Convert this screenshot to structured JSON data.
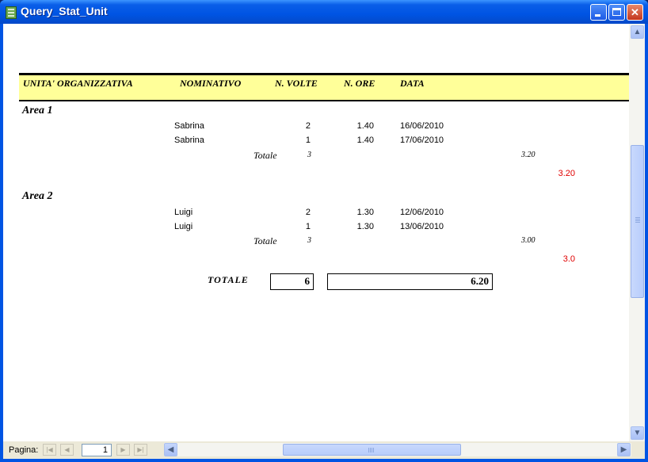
{
  "window": {
    "title": "Query_Stat_Unit"
  },
  "report": {
    "columns": {
      "unit": "UNITA' ORGANIZZATIVA",
      "name": "NOMINATIVO",
      "count": "N. VOLTE",
      "hours": "N. ORE",
      "date": "DATA"
    },
    "groups": [
      {
        "area": "Area 1",
        "rows": [
          {
            "name": "Sabrina",
            "count": "2",
            "hours": "1.40",
            "date": "16/06/2010"
          },
          {
            "name": "Sabrina",
            "count": "1",
            "hours": "1.40",
            "date": "17/06/2010"
          }
        ],
        "total_label": "Totale",
        "total_count": "3",
        "total_hours": "3.20",
        "total_red": "3.20"
      },
      {
        "area": "Area 2",
        "rows": [
          {
            "name": "Luigi",
            "count": "2",
            "hours": "1.30",
            "date": "12/06/2010"
          },
          {
            "name": "Luigi",
            "count": "1",
            "hours": "1.30",
            "date": "13/06/2010"
          }
        ],
        "total_label": "Totale",
        "total_count": "3",
        "total_hours": "3.00",
        "total_red": "3.0"
      }
    ],
    "grand_total": {
      "label": "TOTALE",
      "count": "6",
      "hours": "6.20"
    }
  },
  "navigation": {
    "page_label": "Pagina:",
    "page_value": "1"
  },
  "colors": {
    "header_band": "#ffff99",
    "total_red": "#e00000",
    "titlebar": "#0054e3"
  }
}
